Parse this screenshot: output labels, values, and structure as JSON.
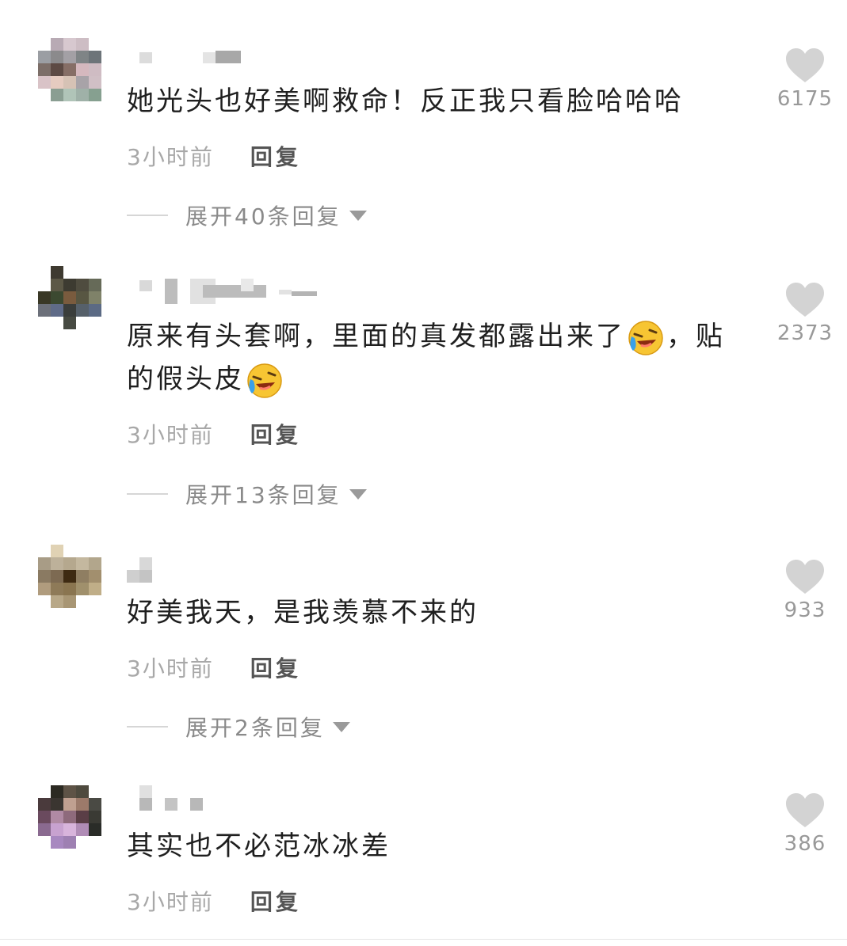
{
  "comments": [
    {
      "text": "她光头也好美啊救命！反正我只看脸哈哈哈",
      "time": "3小时前",
      "reply_label": "回复",
      "likes": "6175",
      "expand_label": "展开40条回复"
    },
    {
      "text_part1": "原来有头套啊，里面的真发都露出来了",
      "text_part2": "，贴的假头皮",
      "emoji": "laughing-crying-emoji",
      "time": "3小时前",
      "reply_label": "回复",
      "likes": "2373",
      "expand_label": "展开13条回复"
    },
    {
      "text": "好美我天，是我羡慕不来的",
      "time": "3小时前",
      "reply_label": "回复",
      "likes": "933",
      "expand_label": "展开2条回复"
    },
    {
      "text": "其实也不必范冰冰差",
      "time": "3小时前",
      "reply_label": "回复",
      "likes": "386"
    }
  ],
  "icons": {
    "like": "heart-icon",
    "expand": "caret-down-icon"
  },
  "colors": {
    "text": "#1f1f1f",
    "muted": "#a8a8a8",
    "heart": "#d3d3d3"
  }
}
